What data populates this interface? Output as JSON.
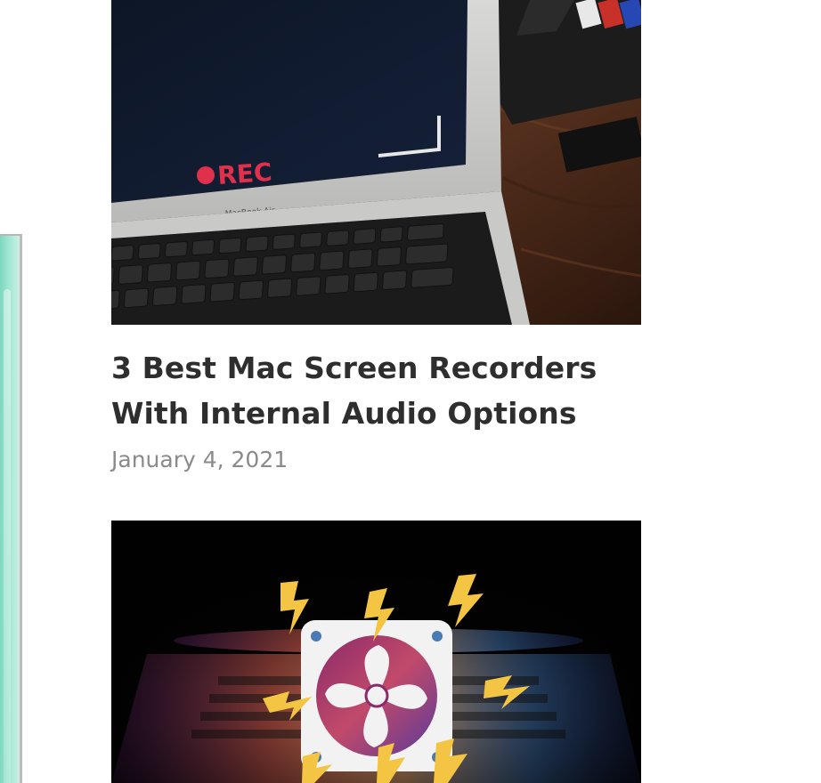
{
  "articles": [
    {
      "title": "3 Best Mac Screen Recorders With Internal Audio Options",
      "date": "January 4, 2021",
      "image": {
        "icon": "macbook-recording-image",
        "rec_label": "REC",
        "brand_label": "MacBook Air"
      }
    },
    {
      "image": {
        "icon": "fan-overheating-image"
      }
    }
  ]
}
